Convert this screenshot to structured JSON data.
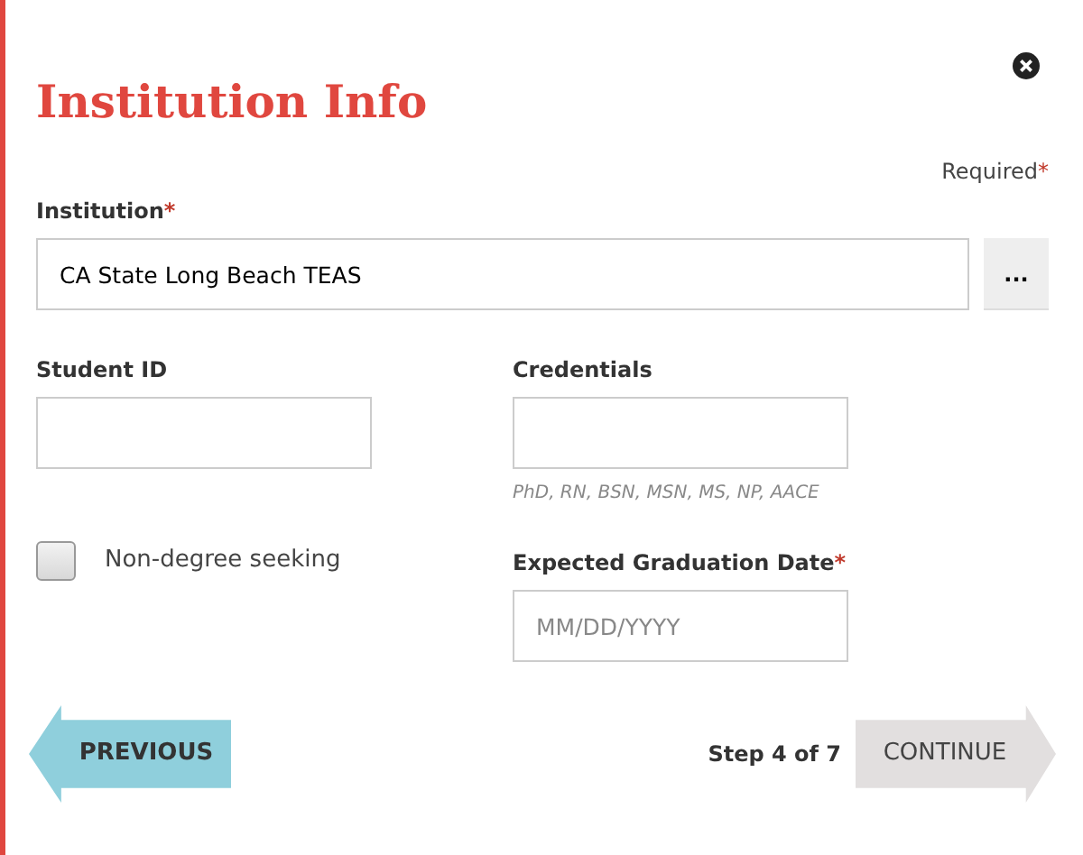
{
  "title": "Institution Info",
  "required_note": {
    "text": "Required",
    "mark": "*"
  },
  "institution": {
    "label": "Institution",
    "required_mark": "*",
    "value": "CA State Long Beach TEAS",
    "browse_button": "..."
  },
  "student_id": {
    "label": "Student ID"
  },
  "credentials": {
    "label": "Credentials",
    "hint": "PhD, RN, BSN, MSN, MS, NP, AACE"
  },
  "non_degree": {
    "label": "Non-degree seeking",
    "checked": false
  },
  "graduation_date": {
    "label": "Expected Graduation Date",
    "required_mark": "*",
    "placeholder": "MM/DD/YYYY"
  },
  "previous_button": "PREVIOUS",
  "step": "Step 4 of 7",
  "continue_button": {
    "label": "CONTINUE",
    "disabled": true
  }
}
